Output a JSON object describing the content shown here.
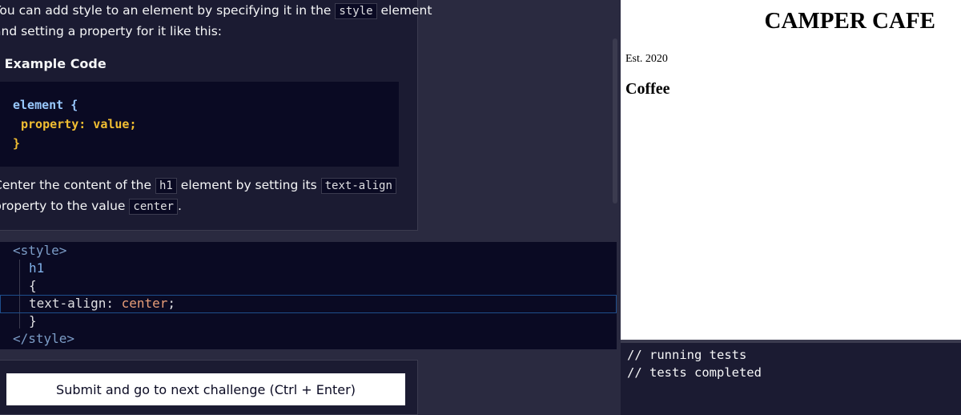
{
  "instructions": {
    "line1_a": "You can add style to an element by specifying it in the",
    "line1_code": "style",
    "line1_b": "element",
    "line2": "and setting a property for it like this:",
    "details_arrow": "▾",
    "details_label": "Example Code",
    "example_code": [
      "element {",
      "property: value;",
      "}"
    ],
    "task_line1_a": "Center the content of the",
    "task_code1": "h1",
    "task_line1_b": "element by setting its",
    "task_code2": "text-align",
    "task_line2_a": "property to the value",
    "task_code3": "center",
    "task_line2_b": "."
  },
  "editor": {
    "lines": [
      "<style>",
      "h1",
      "{",
      "text-align:",
      "center",
      ";",
      "}",
      "</style>"
    ]
  },
  "submit": {
    "label": "Submit and go to next challenge (Ctrl + Enter)"
  },
  "preview": {
    "title": "CAMPER CAFE",
    "est": "Est. 2020",
    "heading": "Coffee"
  },
  "console": {
    "lines": [
      "// running tests",
      "// tests completed"
    ]
  },
  "colors": {
    "background": "#2a2a40",
    "panel": "#1b1b32",
    "code_bg": "#0a0a23",
    "accent_yellow": "#f1be32",
    "accent_blue": "#99c9ff"
  }
}
